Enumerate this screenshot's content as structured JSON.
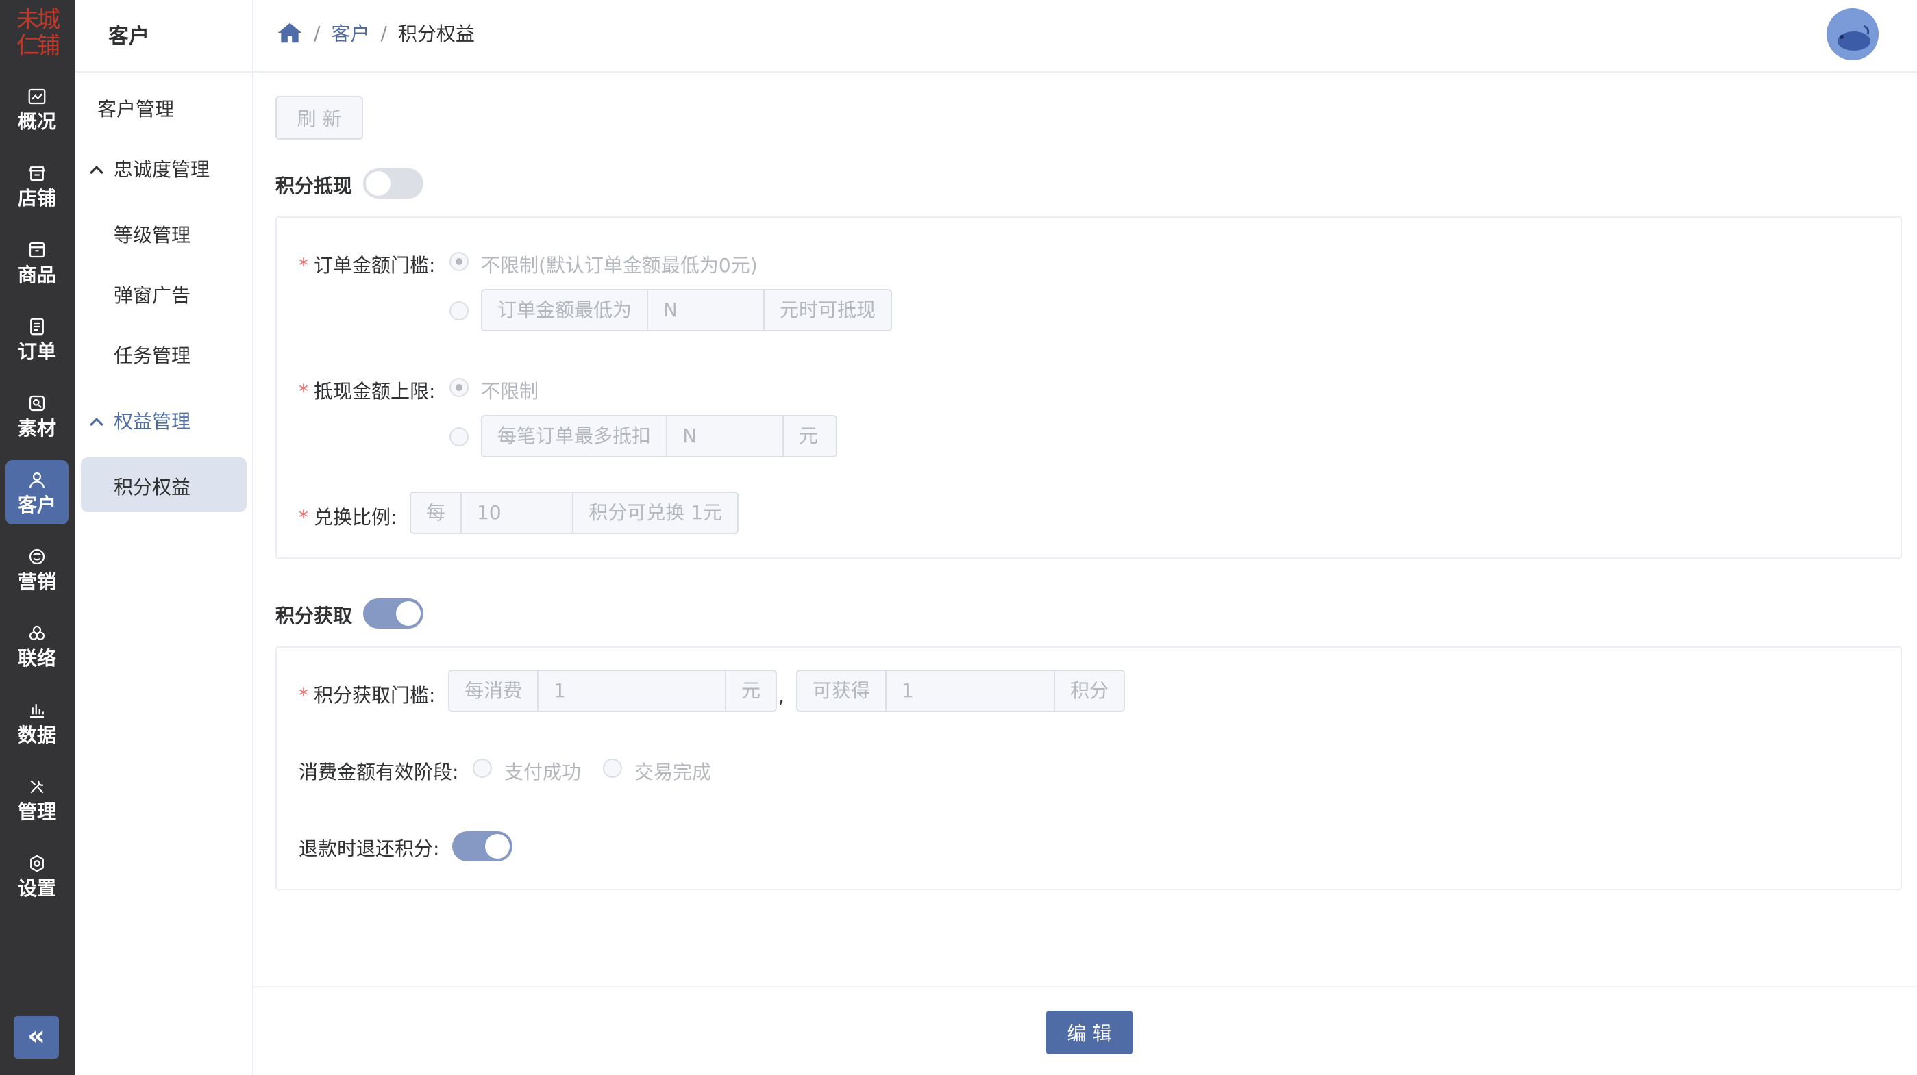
{
  "sidebar": {
    "logo_text": "未城仁铺",
    "items": [
      {
        "label": "概况",
        "icon": "chart-line-icon"
      },
      {
        "label": "店铺",
        "icon": "store-icon"
      },
      {
        "label": "商品",
        "icon": "box-icon"
      },
      {
        "label": "订单",
        "icon": "order-icon"
      },
      {
        "label": "素材",
        "icon": "image-icon"
      },
      {
        "label": "客户",
        "icon": "user-icon",
        "active": true
      },
      {
        "label": "营销",
        "icon": "marketing-icon"
      },
      {
        "label": "联络",
        "icon": "connect-icon"
      },
      {
        "label": "数据",
        "icon": "bar-chart-icon"
      },
      {
        "label": "管理",
        "icon": "tools-icon"
      },
      {
        "label": "设置",
        "icon": "gear-icon"
      }
    ],
    "collapse_label": "«"
  },
  "submenu": {
    "title": "客户",
    "items": [
      {
        "label": "客户管理"
      },
      {
        "label": "忠诚度管理"
      },
      {
        "label": "等级管理"
      },
      {
        "label": "弹窗广告"
      },
      {
        "label": "任务管理"
      },
      {
        "label": "权益管理"
      },
      {
        "label": "积分权益"
      }
    ]
  },
  "header": {
    "breadcrumb": [
      {
        "label": "客户"
      },
      {
        "label": "积分权益"
      }
    ],
    "separator": "/"
  },
  "toolbar": {
    "refresh_label": "刷 新"
  },
  "points_redeem": {
    "title": "积分抵现",
    "enabled": false,
    "order_threshold": {
      "label": "订单金额门槛:",
      "opt_unlimited": "不限制(默认订单金额最低为0元)",
      "prefix": "订单金额最低为",
      "value": "N",
      "suffix": "元时可抵现"
    },
    "cap": {
      "label": "抵现金额上限:",
      "opt_unlimited": "不限制",
      "prefix": "每笔订单最多抵扣",
      "value": "N",
      "suffix": "元"
    },
    "ratio": {
      "label": "兑换比例:",
      "prefix": "每",
      "value": "10",
      "suffix": "积分可兑换 1元"
    }
  },
  "points_earn": {
    "title": "积分获取",
    "enabled": true,
    "threshold": {
      "label": "积分获取门槛:",
      "spend_prefix": "每消费",
      "spend_value": "1",
      "spend_suffix": "元",
      "separator": ",",
      "earn_prefix": "可获得",
      "earn_value": "1",
      "earn_suffix": "积分"
    },
    "valid_stage": {
      "label": "消费金额有效阶段:",
      "opt_paid": "支付成功",
      "opt_done": "交易完成"
    },
    "refund": {
      "label": "退款时退还积分:",
      "enabled": true
    }
  },
  "footer": {
    "edit_label": "编 辑"
  }
}
